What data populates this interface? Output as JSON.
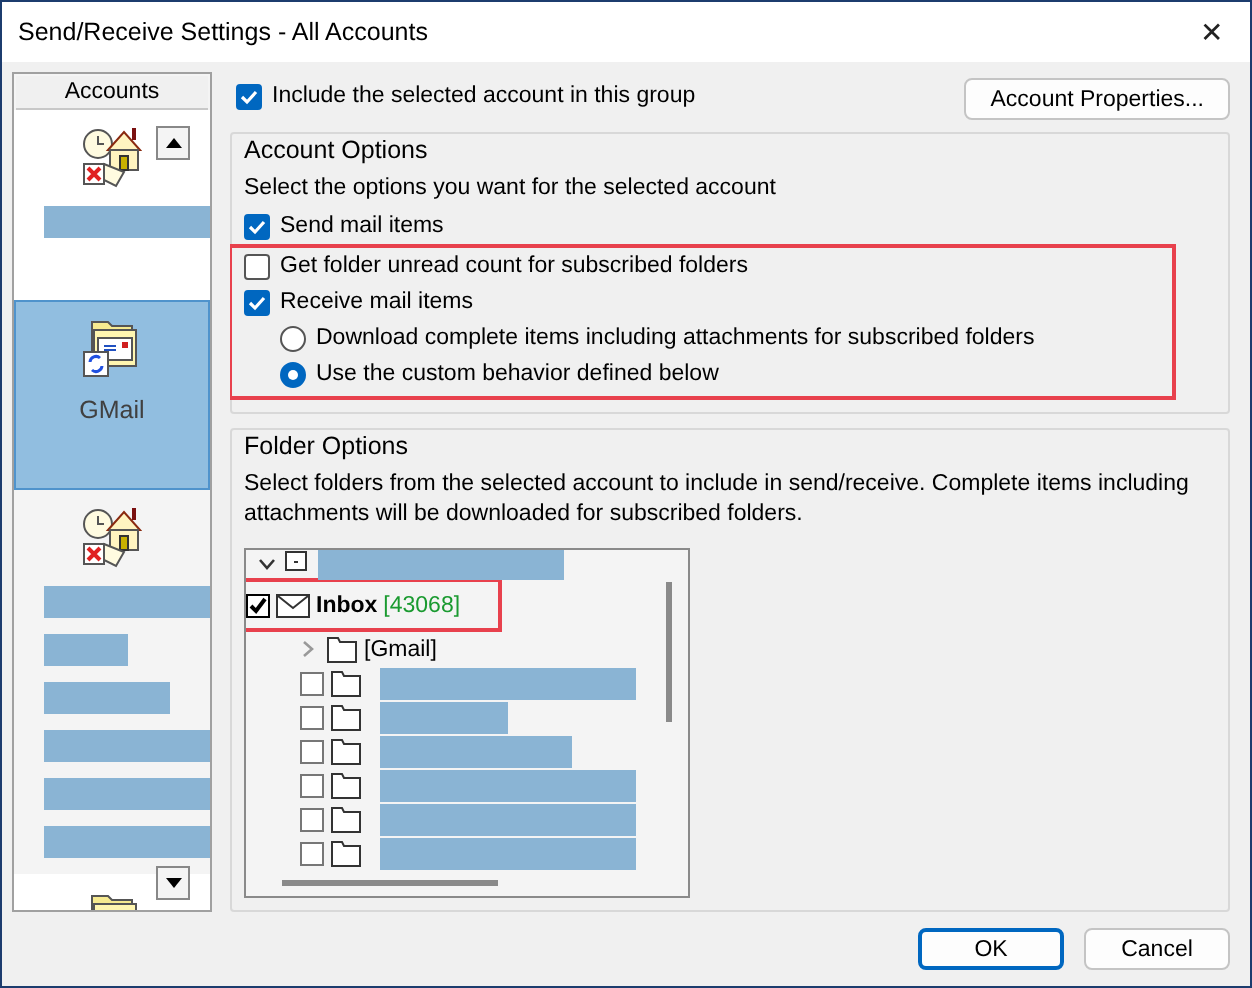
{
  "window": {
    "title": "Send/Receive Settings - All Accounts",
    "close": "✕"
  },
  "accounts": {
    "header": "Accounts",
    "items": [
      {
        "kind": "local",
        "selected": false,
        "redacted": true
      },
      {
        "kind": "mail",
        "selected": true,
        "label": "GMail"
      },
      {
        "kind": "local",
        "selected": false,
        "redacted": true,
        "long": true
      },
      {
        "kind": "mail",
        "selected": false
      }
    ]
  },
  "include": {
    "label": "Include the selected account in this group",
    "checked": true
  },
  "account_properties": "Account Properties...",
  "account_options": {
    "title": "Account Options",
    "description": "Select the options you want for the selected account",
    "options": [
      {
        "kind": "checkbox",
        "label": "Send mail items",
        "checked": true,
        "highlighted": false
      },
      {
        "kind": "checkbox",
        "label": "Get folder unread count for subscribed folders",
        "checked": false,
        "highlighted": true
      },
      {
        "kind": "checkbox",
        "label": "Receive mail items",
        "checked": true,
        "highlighted": true,
        "children": [
          {
            "kind": "radio",
            "label": "Download complete items including attachments for subscribed folders",
            "selected": false
          },
          {
            "kind": "radio",
            "label": "Use the custom behavior defined below",
            "selected": true
          }
        ]
      }
    ]
  },
  "folder_options": {
    "title": "Folder Options",
    "description": "Select folders from the selected account to include in send/receive. Complete items including attachments will be downloaded for subscribed folders.",
    "tree": [
      {
        "kind": "account",
        "expanded": true,
        "children": [
          {
            "kind": "inbox",
            "label": "Inbox",
            "count": "[43068]",
            "checked": true,
            "highlighted": true
          },
          {
            "kind": "group",
            "label": "[Gmail]",
            "expanded": false
          },
          {
            "kind": "folder",
            "checked": false
          },
          {
            "kind": "folder",
            "checked": false
          },
          {
            "kind": "folder",
            "checked": false
          },
          {
            "kind": "folder",
            "checked": false
          },
          {
            "kind": "folder",
            "checked": false
          },
          {
            "kind": "folder",
            "checked": false
          }
        ]
      }
    ]
  },
  "buttons": [
    {
      "label": "OK",
      "default": true
    },
    {
      "label": "Cancel",
      "default": false
    }
  ]
}
